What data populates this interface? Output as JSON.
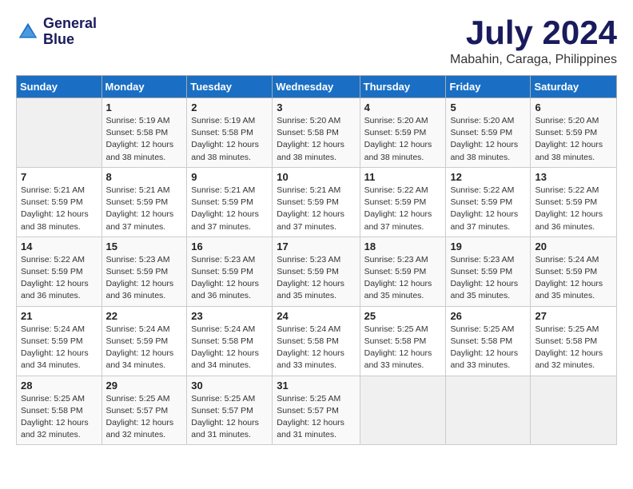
{
  "logo": {
    "line1": "General",
    "line2": "Blue"
  },
  "title": "July 2024",
  "location": "Mabahin, Caraga, Philippines",
  "header": {
    "days": [
      "Sunday",
      "Monday",
      "Tuesday",
      "Wednesday",
      "Thursday",
      "Friday",
      "Saturday"
    ]
  },
  "weeks": [
    [
      {
        "day": "",
        "info": ""
      },
      {
        "day": "1",
        "info": "Sunrise: 5:19 AM\nSunset: 5:58 PM\nDaylight: 12 hours\nand 38 minutes."
      },
      {
        "day": "2",
        "info": "Sunrise: 5:19 AM\nSunset: 5:58 PM\nDaylight: 12 hours\nand 38 minutes."
      },
      {
        "day": "3",
        "info": "Sunrise: 5:20 AM\nSunset: 5:58 PM\nDaylight: 12 hours\nand 38 minutes."
      },
      {
        "day": "4",
        "info": "Sunrise: 5:20 AM\nSunset: 5:59 PM\nDaylight: 12 hours\nand 38 minutes."
      },
      {
        "day": "5",
        "info": "Sunrise: 5:20 AM\nSunset: 5:59 PM\nDaylight: 12 hours\nand 38 minutes."
      },
      {
        "day": "6",
        "info": "Sunrise: 5:20 AM\nSunset: 5:59 PM\nDaylight: 12 hours\nand 38 minutes."
      }
    ],
    [
      {
        "day": "7",
        "info": "Sunrise: 5:21 AM\nSunset: 5:59 PM\nDaylight: 12 hours\nand 38 minutes."
      },
      {
        "day": "8",
        "info": "Sunrise: 5:21 AM\nSunset: 5:59 PM\nDaylight: 12 hours\nand 37 minutes."
      },
      {
        "day": "9",
        "info": "Sunrise: 5:21 AM\nSunset: 5:59 PM\nDaylight: 12 hours\nand 37 minutes."
      },
      {
        "day": "10",
        "info": "Sunrise: 5:21 AM\nSunset: 5:59 PM\nDaylight: 12 hours\nand 37 minutes."
      },
      {
        "day": "11",
        "info": "Sunrise: 5:22 AM\nSunset: 5:59 PM\nDaylight: 12 hours\nand 37 minutes."
      },
      {
        "day": "12",
        "info": "Sunrise: 5:22 AM\nSunset: 5:59 PM\nDaylight: 12 hours\nand 37 minutes."
      },
      {
        "day": "13",
        "info": "Sunrise: 5:22 AM\nSunset: 5:59 PM\nDaylight: 12 hours\nand 36 minutes."
      }
    ],
    [
      {
        "day": "14",
        "info": "Sunrise: 5:22 AM\nSunset: 5:59 PM\nDaylight: 12 hours\nand 36 minutes."
      },
      {
        "day": "15",
        "info": "Sunrise: 5:23 AM\nSunset: 5:59 PM\nDaylight: 12 hours\nand 36 minutes."
      },
      {
        "day": "16",
        "info": "Sunrise: 5:23 AM\nSunset: 5:59 PM\nDaylight: 12 hours\nand 36 minutes."
      },
      {
        "day": "17",
        "info": "Sunrise: 5:23 AM\nSunset: 5:59 PM\nDaylight: 12 hours\nand 35 minutes."
      },
      {
        "day": "18",
        "info": "Sunrise: 5:23 AM\nSunset: 5:59 PM\nDaylight: 12 hours\nand 35 minutes."
      },
      {
        "day": "19",
        "info": "Sunrise: 5:23 AM\nSunset: 5:59 PM\nDaylight: 12 hours\nand 35 minutes."
      },
      {
        "day": "20",
        "info": "Sunrise: 5:24 AM\nSunset: 5:59 PM\nDaylight: 12 hours\nand 35 minutes."
      }
    ],
    [
      {
        "day": "21",
        "info": "Sunrise: 5:24 AM\nSunset: 5:59 PM\nDaylight: 12 hours\nand 34 minutes."
      },
      {
        "day": "22",
        "info": "Sunrise: 5:24 AM\nSunset: 5:59 PM\nDaylight: 12 hours\nand 34 minutes."
      },
      {
        "day": "23",
        "info": "Sunrise: 5:24 AM\nSunset: 5:58 PM\nDaylight: 12 hours\nand 34 minutes."
      },
      {
        "day": "24",
        "info": "Sunrise: 5:24 AM\nSunset: 5:58 PM\nDaylight: 12 hours\nand 33 minutes."
      },
      {
        "day": "25",
        "info": "Sunrise: 5:25 AM\nSunset: 5:58 PM\nDaylight: 12 hours\nand 33 minutes."
      },
      {
        "day": "26",
        "info": "Sunrise: 5:25 AM\nSunset: 5:58 PM\nDaylight: 12 hours\nand 33 minutes."
      },
      {
        "day": "27",
        "info": "Sunrise: 5:25 AM\nSunset: 5:58 PM\nDaylight: 12 hours\nand 32 minutes."
      }
    ],
    [
      {
        "day": "28",
        "info": "Sunrise: 5:25 AM\nSunset: 5:58 PM\nDaylight: 12 hours\nand 32 minutes."
      },
      {
        "day": "29",
        "info": "Sunrise: 5:25 AM\nSunset: 5:57 PM\nDaylight: 12 hours\nand 32 minutes."
      },
      {
        "day": "30",
        "info": "Sunrise: 5:25 AM\nSunset: 5:57 PM\nDaylight: 12 hours\nand 31 minutes."
      },
      {
        "day": "31",
        "info": "Sunrise: 5:25 AM\nSunset: 5:57 PM\nDaylight: 12 hours\nand 31 minutes."
      },
      {
        "day": "",
        "info": ""
      },
      {
        "day": "",
        "info": ""
      },
      {
        "day": "",
        "info": ""
      }
    ]
  ]
}
